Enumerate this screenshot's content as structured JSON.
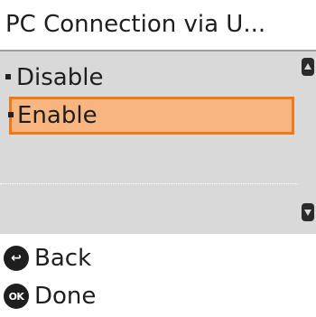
{
  "title": "PC Connection via U...",
  "options": [
    {
      "label": "Disable",
      "selected": false
    },
    {
      "label": "Enable",
      "selected": true
    }
  ],
  "footer": {
    "back_label": "Back",
    "back_icon": "back-arrow-icon",
    "done_label": "Done",
    "done_icon_text": "OK"
  },
  "colors": {
    "highlight_border": "#f07a1a",
    "highlight_fill": "#f8b580",
    "list_background": "#d9d9d9"
  }
}
